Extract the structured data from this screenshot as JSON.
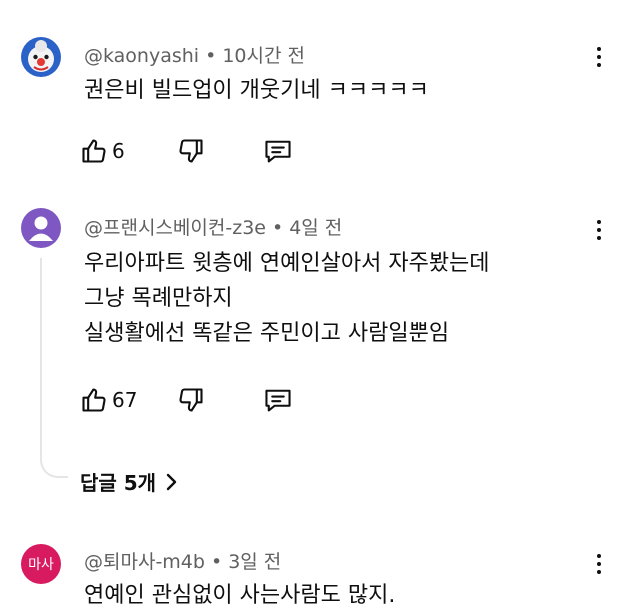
{
  "comments": [
    {
      "author": "@kaonyashi",
      "time": "10시간 전",
      "lines": [
        "권은비 빌드업이 개웃기네 ㅋㅋㅋㅋㅋ"
      ],
      "likes": "6",
      "avatar": {
        "type": "clown-icon"
      }
    },
    {
      "author": "@프랜시스베이컨-z3e",
      "time": "4일 전",
      "lines": [
        "우리아파트 윗층에 연예인살아서 자주봤는데",
        "그냥 목례만하지",
        "실생활에선 똑같은 주민이고 사람일뿐임"
      ],
      "likes": "67",
      "avatar": {
        "type": "default-user-icon",
        "color": "#7e57c2"
      },
      "replies_label": "답글 5개"
    },
    {
      "author": "@퇴마사-m4b",
      "time": "3일 전",
      "lines": [
        "연예인 관심없이 사는사람도 많지."
      ],
      "avatar": {
        "type": "text",
        "text": "마사",
        "color": "#d81b60"
      }
    }
  ],
  "colors": {
    "text": "#0f0f0f",
    "secondary": "#606060",
    "thread": "#e5e5e5"
  }
}
